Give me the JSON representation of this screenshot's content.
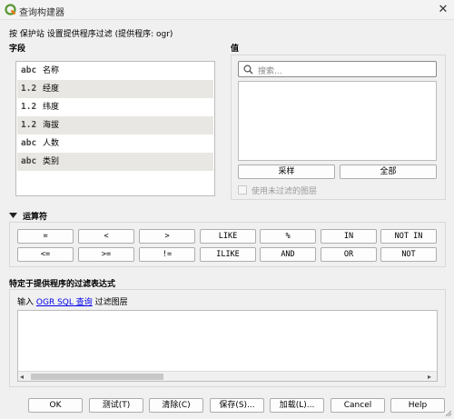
{
  "window": {
    "title": "查询构建器",
    "close": "✕"
  },
  "subtitle": "按 保护站 设置提供程序过滤 (提供程序: ogr)",
  "fields": {
    "label": "字段",
    "items": [
      {
        "type": "abc",
        "name": "名称"
      },
      {
        "type": "1.2",
        "name": "经度"
      },
      {
        "type": "1.2",
        "name": "纬度"
      },
      {
        "type": "1.2",
        "name": "海拔"
      },
      {
        "type": "abc",
        "name": "人数"
      },
      {
        "type": "abc",
        "name": "类别"
      }
    ]
  },
  "values": {
    "label": "值",
    "search_placeholder": "搜索...",
    "sample_button": "采样",
    "all_button": "全部",
    "use_unfiltered_label": "使用未过滤的图层"
  },
  "operators": {
    "label": "运算符",
    "row1": [
      "=",
      "<",
      ">",
      "LIKE",
      "%",
      "IN",
      "NOT IN"
    ],
    "row2": [
      "<=",
      ">=",
      "!=",
      "ILIKE",
      "AND",
      "OR",
      "NOT"
    ]
  },
  "expression": {
    "label": "特定于提供程序的过滤表达式",
    "hint_prefix": "输入",
    "hint_link": "OGR SQL 查询",
    "hint_suffix": "过滤图层",
    "value": ""
  },
  "footer": {
    "ok": "OK",
    "test": "测试(T)",
    "clear": "清除(C)",
    "save": "保存(S)...",
    "load": "加载(L)...",
    "cancel": "Cancel",
    "help": "Help"
  }
}
